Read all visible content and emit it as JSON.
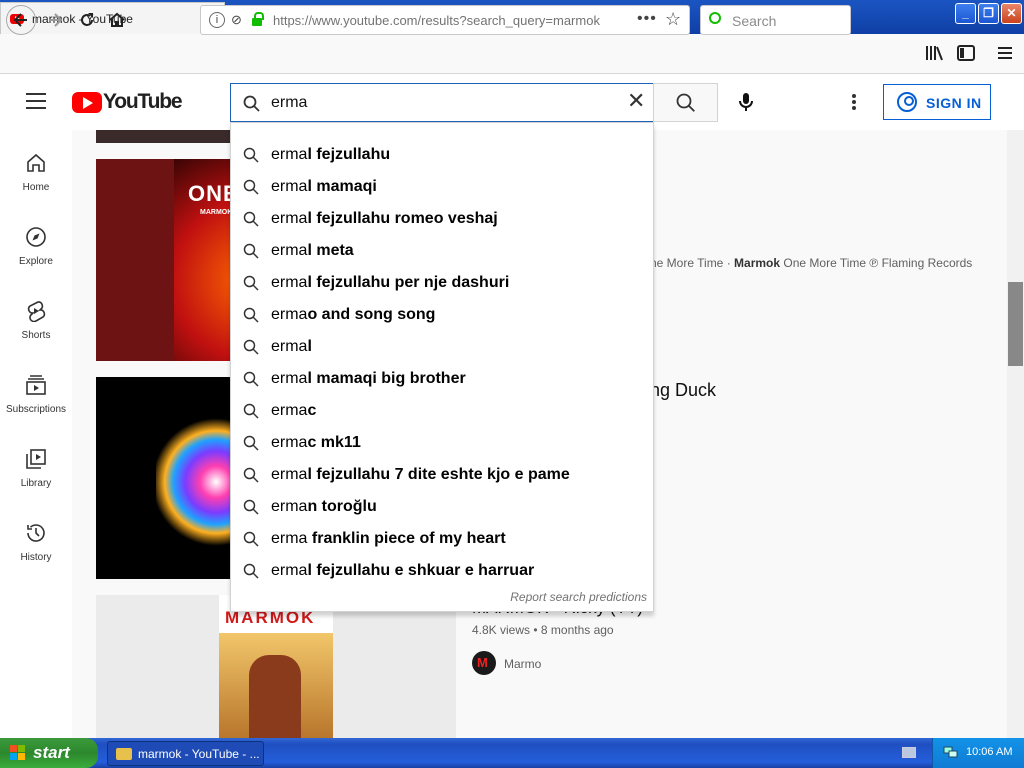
{
  "browser": {
    "tab_title": "marmok - YouTube",
    "tab_close": "×",
    "new_tab": "+",
    "url": "https://www.youtube.com/results?search_query=marmok",
    "url_more": "•••",
    "search_placeholder": "Search",
    "window_min": "_",
    "window_restore": "❐",
    "window_close": "✕"
  },
  "youtube": {
    "logo_text": "YouTube",
    "search_query": "erma",
    "sign_in": "SIGN IN",
    "more": "⋮"
  },
  "sidebar": {
    "items": [
      {
        "label": "Home",
        "icon": "home-icon"
      },
      {
        "label": "Explore",
        "icon": "compass-icon"
      },
      {
        "label": "Shorts",
        "icon": "shorts-icon"
      },
      {
        "label": "Subscriptions",
        "icon": "subscriptions-icon"
      },
      {
        "label": "Library",
        "icon": "library-icon"
      },
      {
        "label": "History",
        "icon": "history-icon"
      }
    ]
  },
  "suggestions": [
    {
      "prefix": "erma",
      "rest": "l fejzullahu"
    },
    {
      "prefix": "erma",
      "rest": "l mamaqi"
    },
    {
      "prefix": "erma",
      "rest": "l fejzullahu romeo veshaj"
    },
    {
      "prefix": "erma",
      "rest": "l meta"
    },
    {
      "prefix": "erma",
      "rest": "l fejzullahu per nje dashuri"
    },
    {
      "prefix": "erma",
      "rest": "o and song song"
    },
    {
      "prefix": "erma",
      "rest": "l"
    },
    {
      "prefix": "erma",
      "rest": "l mamaqi big brother"
    },
    {
      "prefix": "erma",
      "rest": "c"
    },
    {
      "prefix": "erma",
      "rest": "c mk11"
    },
    {
      "prefix": "erma",
      "rest": "l fejzullahu 7 dite eshte kjo e pame"
    },
    {
      "prefix": "erma",
      "rest": "n toroğlu"
    },
    {
      "prefix": "erma",
      "rest": " franklin piece of my heart"
    },
    {
      "prefix": "erma",
      "rest": "l fejzullahu e shkuar e harruar"
    }
  ],
  "report_predictions": "Report search predictions",
  "results": {
    "video1": {
      "thumb_text": "ONE",
      "thumb_sub": "MARMOK",
      "meta_a": "ne More Time · ",
      "meta_b": "Marmok",
      "meta_c": " One More Time ℗ Flaming Records"
    },
    "video2": {
      "title_fragment": "ng Duck"
    },
    "video3": {
      "thumb_text": "MARMOK",
      "title_fragment": "MARMOK - Ricky (YT)",
      "views": "4.8K views • 8 months ago",
      "channel": "Marmo"
    }
  },
  "taskbar": {
    "start": "start",
    "task_item": "marmok - YouTube - ...",
    "clock": "10:06 AM"
  },
  "colors": {
    "accent_blue": "#065fd4",
    "youtube_red": "#ff0000",
    "xp_taskbar": "#245edb",
    "xp_start": "#3c9a3c"
  }
}
